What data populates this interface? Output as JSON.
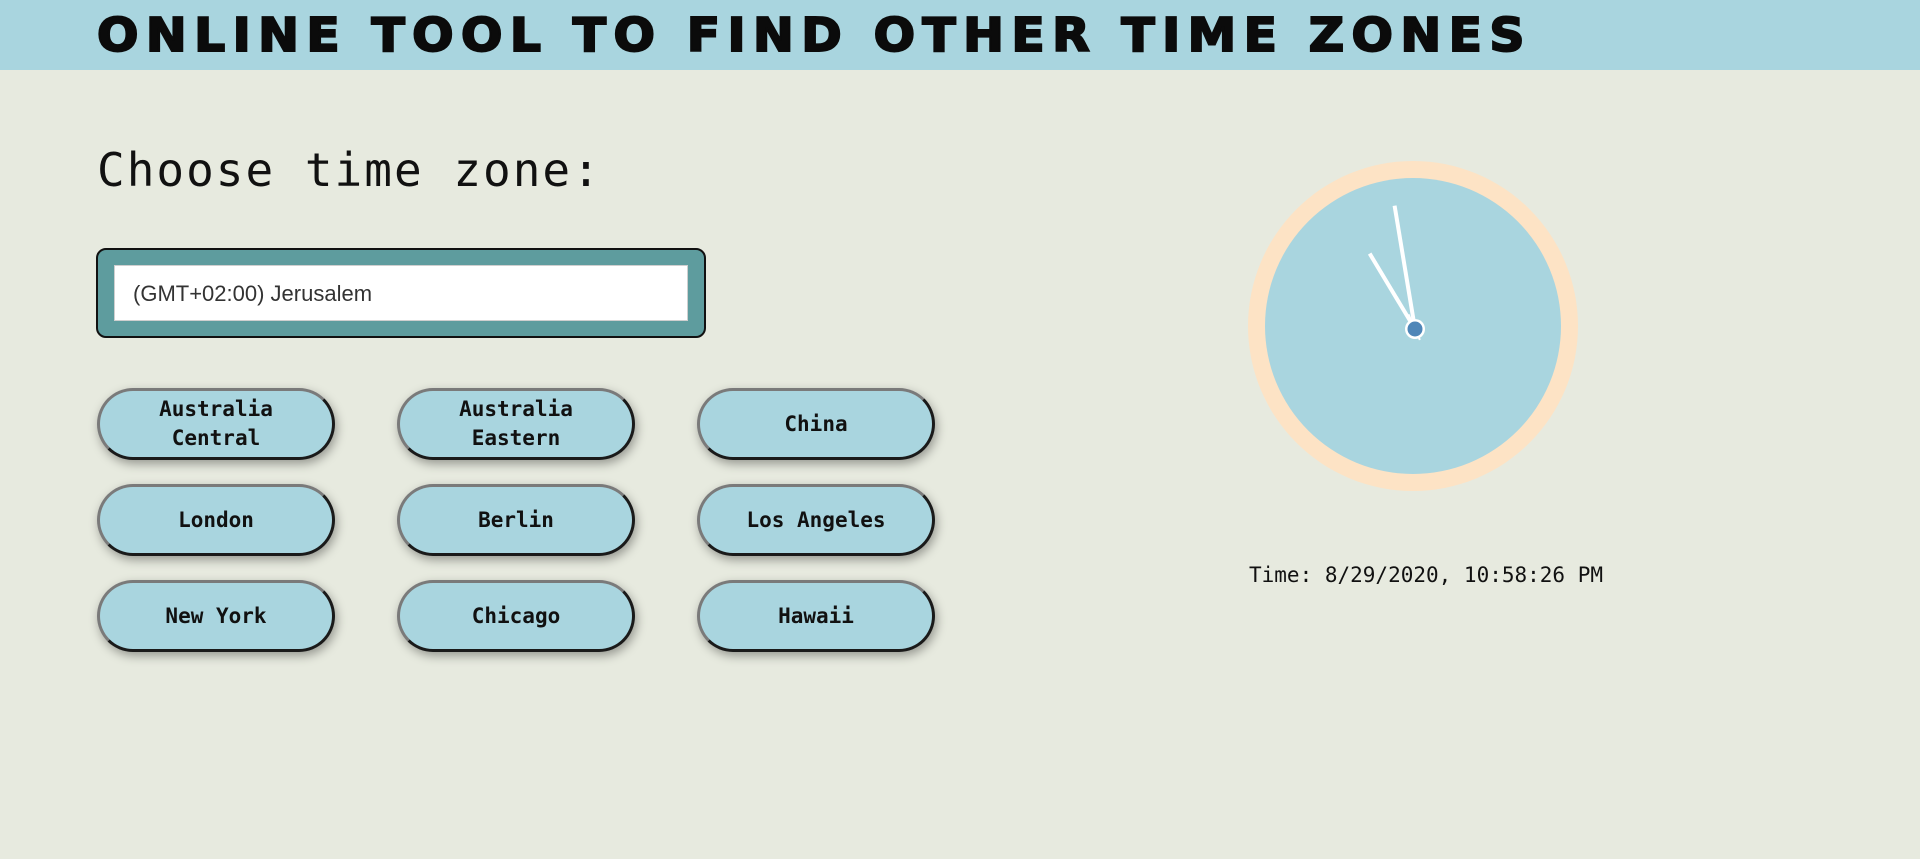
{
  "header": {
    "title": "Online tool to find other time zones"
  },
  "main": {
    "choose_label": "Choose time zone:",
    "select": {
      "selected_value": "(GMT+02:00) Jerusalem"
    },
    "buttons": [
      "Australia Central",
      "Australia Eastern",
      "China",
      "London",
      "Berlin",
      "Los Angeles",
      "New York",
      "Chicago",
      "Hawaii"
    ]
  },
  "clock": {
    "hour": 10,
    "minute": 58,
    "second": 26,
    "rim_color": "#fde3c5",
    "face_color": "#a9d5df",
    "hand_color": "#ffffff",
    "center_color": "#4f86b8"
  },
  "time_readout": "Time: 8/29/2020, 10:58:26 PM"
}
